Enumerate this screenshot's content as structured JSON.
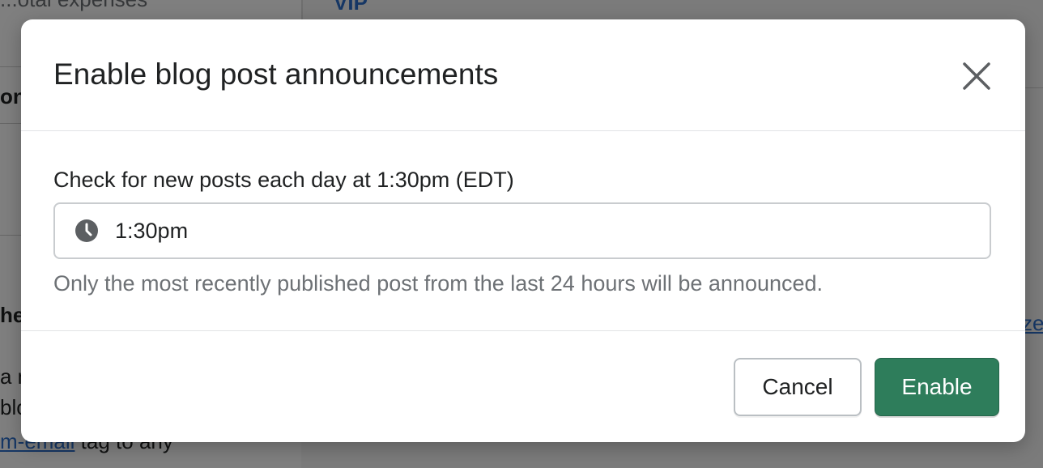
{
  "background": {
    "top_left_text": "...otal expenses",
    "vip_link": "VIP",
    "left_tab_fragment": "on",
    "left_heading_fragment": "he",
    "left_line1": "a n",
    "left_line2": "blo",
    "bottom_link": "m-email",
    "bottom_text": " tag to any",
    "right_link_fragment": "ze"
  },
  "modal": {
    "title": "Enable blog post announcements",
    "close_icon": "close-icon",
    "field_label": "Check for new posts each day at 1:30pm (EDT)",
    "time_value": "1:30pm",
    "time_icon": "clock-icon",
    "help_text": "Only the most recently published post from the last 24 hours will be announced.",
    "cancel_label": "Cancel",
    "enable_label": "Enable"
  },
  "colors": {
    "primary": "#2e7d5b",
    "text": "#202223",
    "subdued": "#6d7175",
    "link": "#2c6ecb"
  }
}
